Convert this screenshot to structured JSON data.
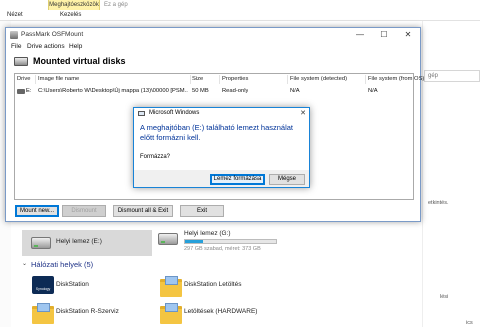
{
  "explorer": {
    "ribbon_tool_tab": "Meghajtóeszközök",
    "title_fragment": "Ez a gép",
    "tabs": [
      "Nézet",
      "Kezelés"
    ],
    "search_placeholder": "gép",
    "side_texts": [
      "etkintés.",
      "lési",
      "ics"
    ],
    "drives": [
      {
        "name": "Helyi lemez (E:)"
      },
      {
        "name": "Helyi lemez (G:)",
        "detail": "297 GB szabad, méret: 373 GB",
        "used_fraction": 0.2
      }
    ],
    "network_section": "Hálózati helyek (5)",
    "network_items": [
      "DiskStation",
      "DiskStation Letöltés",
      "DiskStation R-Szerviz",
      "Letöltések (HARDWARE)"
    ],
    "colors": {
      "accent": "#26a0da",
      "section": "#1e3287"
    }
  },
  "osfmount": {
    "title": "PassMark OSFMount",
    "menu": [
      "File",
      "Drive actions",
      "Help"
    ],
    "header": "Mounted virtual disks",
    "columns": [
      "Drive",
      "Image file name",
      "Size",
      "Properties",
      "File system (detected)",
      "File system (from OS)"
    ],
    "rows": [
      {
        "drive": "E:",
        "image": "C:\\Users\\Roberto W\\Desktop\\Új mappa (13)\\00000 [PSM...",
        "size": "50 MB",
        "properties": "Read-only",
        "fs_detected": "N/A",
        "fs_os": "N/A"
      }
    ],
    "buttons": {
      "mount": "Mount new...",
      "dismount": "Dismount",
      "dismount_all": "Dismount all & Exit",
      "exit": "Exit"
    },
    "window_controls": {
      "minimize": "—",
      "maximize": "☐",
      "close": "✕"
    }
  },
  "dialog": {
    "title": "Microsoft Windows",
    "message": "A meghajtóban (E:) található lemezt használat előtt formázni kell.",
    "question": "Formázza?",
    "buttons": {
      "format": "Lemez formázása",
      "cancel": "Mégse"
    },
    "close": "✕"
  }
}
